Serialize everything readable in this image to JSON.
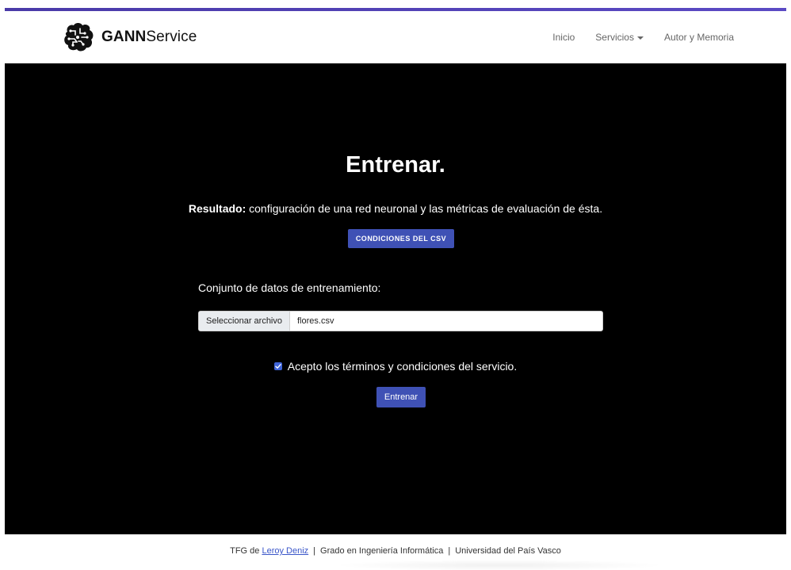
{
  "brand": {
    "name_bold": "GANN",
    "name_rest": "Service",
    "logo_icon": "brain-circuit-icon"
  },
  "nav": {
    "items": [
      {
        "label": "Inicio"
      },
      {
        "label": "Servicios"
      },
      {
        "label": "Autor y Memoria"
      }
    ]
  },
  "main": {
    "title": "Entrenar.",
    "result_label": "Resultado:",
    "result_text": " configuración de una red neuronal y las métricas de evaluación de ésta.",
    "csv_button": "CONDICIONES DEL CSV",
    "dataset_label": "Conjunto de datos de entrenamiento:",
    "file_button": "Seleccionar archivo",
    "file_name": "flores.csv",
    "terms_text": "Acepto los términos y condiciones del servicio.",
    "terms_checked": true,
    "submit_button": "Entrenar"
  },
  "footer": {
    "prefix": "TFG de ",
    "author": "Leroy Deniz",
    "separator": "|",
    "degree": "Grado en Ingeniería Informática",
    "university": "Universidad del País Vasco"
  },
  "colors": {
    "accent": "#3f51b5",
    "hero_bg": "#000000",
    "top_bar": "#4a3aa8"
  }
}
